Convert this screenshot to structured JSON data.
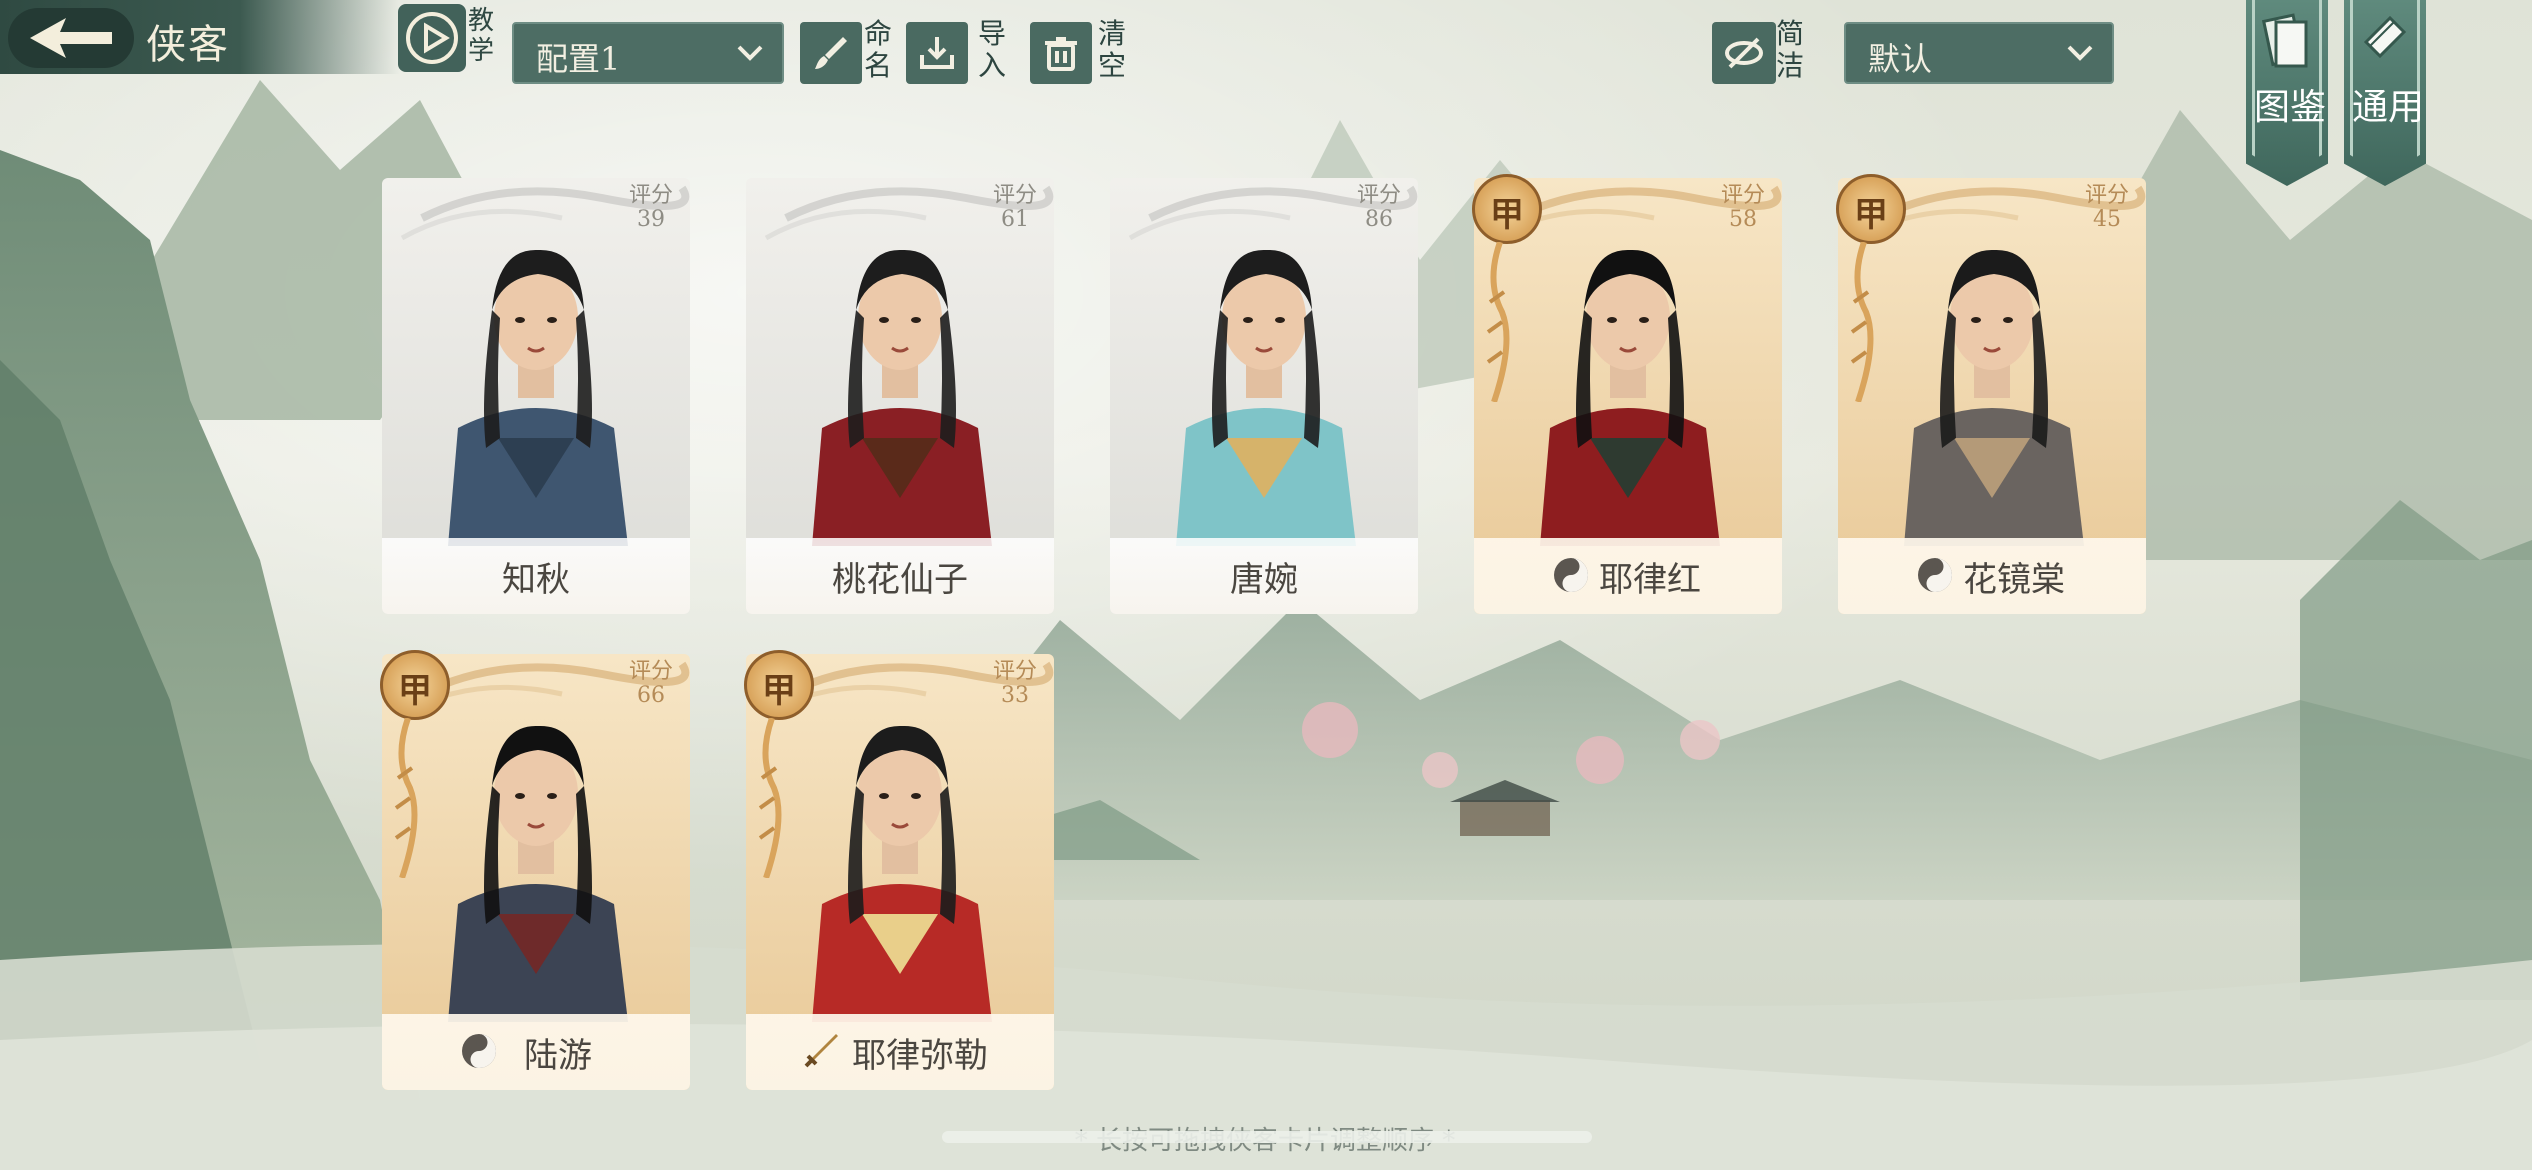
{
  "header": {
    "title": "侠客",
    "tutorial_label": "教学",
    "config_select": "配置1",
    "rename_label": "命名",
    "import_label": "导入",
    "clear_label": "清空",
    "simple_label": "简洁",
    "sort_select": "默认",
    "codex_label": "图鉴",
    "general_label": "通用"
  },
  "score_label": "评分",
  "cards": [
    {
      "name": "知秋",
      "score": "39",
      "grade": "",
      "rarity": "common",
      "symbol": ""
    },
    {
      "name": "桃花仙子",
      "score": "61",
      "grade": "",
      "rarity": "common",
      "symbol": ""
    },
    {
      "name": "唐婉",
      "score": "86",
      "grade": "",
      "rarity": "common",
      "symbol": ""
    },
    {
      "name": "耶律红",
      "score": "58",
      "grade": "甲",
      "rarity": "rare",
      "symbol": "taiji-icon"
    },
    {
      "name": "花镜棠",
      "score": "45",
      "grade": "甲",
      "rarity": "rare",
      "symbol": "taiji-icon"
    },
    {
      "name": "陆游",
      "score": "66",
      "grade": "甲",
      "rarity": "rare",
      "symbol": "taiji-icon"
    },
    {
      "name": "耶律弥勒",
      "score": "33",
      "grade": "甲",
      "rarity": "rare",
      "symbol": "sword-icon"
    }
  ],
  "bottom_hint": "* 长按可拖拽侠客卡片调整顺序 *",
  "colors": {
    "accent": "#4a6a61",
    "gold": "#d9a45c"
  }
}
